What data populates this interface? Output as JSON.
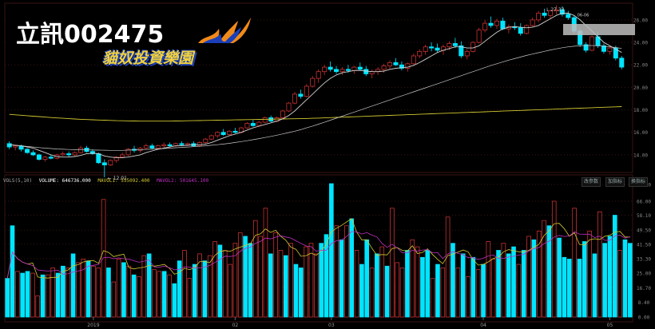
{
  "header": {
    "title": "立訊002475",
    "logo_text": "貓奴投資樂園"
  },
  "colors": {
    "up": "#c83232",
    "down": "#00e5ff",
    "ma_short": "#d0d0d0",
    "ma_long": "#c8c8c8",
    "ma_200": "#d2c830",
    "vol_ma1": "#d2c830",
    "vol_ma2": "#c030c0",
    "grid": "#3a1414"
  },
  "volume_panel": {
    "indicator": "VOLS(5,10)",
    "volume_label": "VOLUME: 646736.000",
    "mavol1_label": "MAVOL1: 555092.400",
    "mavol2_label": "MAVOL2: 501645.100",
    "buttons": [
      "改参数",
      "加指标",
      "换指标"
    ]
  },
  "chart_data": [
    {
      "type": "candlestick",
      "yaxis_ticks": [
        "26.00",
        "24.00",
        "22.00",
        "20.00",
        "18.00",
        "16.00",
        "14.00"
      ],
      "ylim": [
        13,
        27.2
      ],
      "annotations": [
        {
          "text": "12.01",
          "value": 12.01
        },
        {
          "text": "27.33",
          "value": 27.33
        },
        {
          "text": "06-06",
          "value": 26.3
        }
      ],
      "ohlc": [
        [
          15.0,
          15.2,
          14.5,
          14.7
        ],
        [
          14.7,
          14.9,
          14.4,
          14.8
        ],
        [
          14.8,
          14.9,
          14.3,
          14.5
        ],
        [
          14.5,
          14.6,
          14.1,
          14.2
        ],
        [
          14.2,
          14.4,
          13.9,
          14.0
        ],
        [
          14.0,
          14.1,
          13.5,
          13.6
        ],
        [
          13.6,
          13.9,
          13.4,
          13.8
        ],
        [
          13.8,
          14.0,
          13.6,
          13.7
        ],
        [
          13.7,
          14.1,
          13.6,
          14.0
        ],
        [
          14.0,
          14.3,
          13.9,
          14.1
        ],
        [
          14.1,
          14.3,
          13.8,
          14.0
        ],
        [
          14.0,
          14.3,
          13.9,
          14.2
        ],
        [
          14.2,
          14.8,
          14.1,
          14.6
        ],
        [
          14.6,
          14.8,
          14.2,
          14.3
        ],
        [
          14.3,
          14.5,
          14.0,
          14.1
        ],
        [
          14.1,
          14.2,
          13.2,
          13.3
        ],
        [
          13.3,
          13.6,
          12.0,
          13.1
        ],
        [
          13.1,
          13.6,
          13.0,
          13.5
        ],
        [
          13.5,
          13.9,
          13.3,
          13.8
        ],
        [
          13.8,
          14.2,
          13.7,
          14.0
        ],
        [
          14.0,
          14.6,
          13.9,
          14.5
        ],
        [
          14.5,
          14.8,
          14.2,
          14.4
        ],
        [
          14.4,
          14.7,
          14.2,
          14.6
        ],
        [
          14.6,
          15.0,
          14.5,
          14.8
        ],
        [
          14.8,
          15.0,
          14.5,
          14.6
        ],
        [
          14.6,
          14.9,
          14.5,
          14.8
        ],
        [
          14.8,
          15.1,
          14.6,
          14.9
        ],
        [
          14.9,
          15.1,
          14.7,
          14.8
        ],
        [
          14.8,
          15.1,
          14.7,
          15.0
        ],
        [
          15.0,
          15.2,
          14.8,
          14.9
        ],
        [
          14.9,
          15.1,
          14.8,
          15.0
        ],
        [
          15.0,
          15.2,
          14.7,
          14.8
        ],
        [
          14.8,
          15.2,
          14.7,
          15.1
        ],
        [
          15.1,
          15.5,
          15.0,
          15.4
        ],
        [
          15.4,
          15.8,
          15.3,
          15.7
        ],
        [
          15.7,
          16.1,
          15.5,
          16.0
        ],
        [
          16.0,
          16.3,
          15.7,
          15.8
        ],
        [
          15.8,
          16.2,
          15.7,
          16.1
        ],
        [
          16.1,
          16.4,
          15.9,
          16.0
        ],
        [
          16.0,
          16.5,
          15.9,
          16.4
        ],
        [
          16.4,
          16.9,
          16.3,
          16.8
        ],
        [
          16.8,
          17.1,
          16.5,
          16.6
        ],
        [
          16.6,
          17.0,
          16.5,
          16.9
        ],
        [
          16.9,
          17.4,
          16.8,
          17.3
        ],
        [
          17.3,
          17.5,
          16.9,
          17.0
        ],
        [
          17.0,
          17.4,
          16.9,
          17.3
        ],
        [
          17.3,
          18.0,
          17.2,
          17.9
        ],
        [
          17.9,
          18.7,
          17.8,
          18.6
        ],
        [
          18.6,
          19.6,
          18.5,
          19.4
        ],
        [
          19.4,
          19.8,
          19.0,
          19.2
        ],
        [
          19.2,
          20.3,
          19.1,
          20.1
        ],
        [
          20.1,
          21.0,
          20.0,
          20.8
        ],
        [
          20.8,
          21.6,
          20.4,
          21.4
        ],
        [
          21.4,
          22.0,
          21.1,
          21.8
        ],
        [
          21.8,
          22.3,
          21.4,
          21.6
        ],
        [
          21.6,
          21.9,
          21.2,
          21.4
        ],
        [
          21.4,
          21.8,
          21.1,
          21.6
        ],
        [
          21.6,
          22.0,
          21.3,
          21.5
        ],
        [
          21.5,
          21.9,
          21.2,
          21.8
        ],
        [
          21.8,
          22.2,
          21.5,
          21.6
        ],
        [
          21.6,
          21.9,
          21.0,
          21.2
        ],
        [
          21.2,
          21.6,
          20.8,
          21.4
        ],
        [
          21.4,
          21.8,
          21.1,
          21.6
        ],
        [
          21.6,
          22.1,
          21.3,
          21.9
        ],
        [
          21.9,
          22.4,
          21.6,
          22.2
        ],
        [
          22.2,
          22.6,
          21.9,
          22.0
        ],
        [
          22.0,
          22.3,
          21.5,
          21.7
        ],
        [
          21.7,
          22.2,
          21.4,
          22.1
        ],
        [
          22.1,
          23.0,
          22.0,
          22.8
        ],
        [
          22.8,
          23.4,
          22.6,
          23.2
        ],
        [
          23.2,
          23.8,
          22.9,
          23.6
        ],
        [
          23.6,
          24.0,
          23.2,
          23.5
        ],
        [
          23.5,
          23.9,
          23.1,
          23.3
        ],
        [
          23.3,
          23.8,
          22.9,
          23.6
        ],
        [
          23.6,
          24.1,
          23.3,
          23.9
        ],
        [
          23.9,
          24.4,
          23.5,
          23.7
        ],
        [
          23.7,
          24.1,
          22.6,
          22.8
        ],
        [
          22.8,
          23.4,
          22.5,
          23.2
        ],
        [
          23.2,
          24.1,
          23.1,
          24.0
        ],
        [
          24.0,
          25.3,
          23.9,
          25.1
        ],
        [
          25.1,
          26.0,
          24.9,
          25.7
        ],
        [
          25.7,
          26.3,
          25.3,
          25.5
        ],
        [
          25.5,
          26.1,
          25.2,
          25.9
        ],
        [
          25.9,
          26.2,
          25.1,
          25.2
        ],
        [
          25.2,
          25.6,
          24.8,
          25.4
        ],
        [
          25.4,
          25.8,
          25.1,
          25.3
        ],
        [
          25.3,
          25.7,
          24.6,
          24.8
        ],
        [
          24.8,
          25.6,
          24.7,
          25.5
        ],
        [
          25.5,
          26.2,
          25.4,
          26.0
        ],
        [
          26.0,
          26.8,
          25.8,
          26.6
        ],
        [
          26.6,
          27.0,
          26.2,
          26.4
        ],
        [
          26.4,
          26.9,
          26.1,
          26.8
        ],
        [
          26.8,
          27.3,
          26.5,
          26.9
        ],
        [
          26.9,
          27.2,
          26.3,
          26.5
        ],
        [
          26.5,
          26.8,
          26.0,
          26.2
        ],
        [
          26.2,
          26.4,
          24.8,
          25.0
        ],
        [
          25.0,
          25.2,
          23.6,
          23.8
        ],
        [
          23.8,
          24.0,
          23.1,
          23.3
        ],
        [
          23.3,
          24.6,
          23.2,
          24.5
        ],
        [
          24.5,
          24.9,
          23.5,
          23.7
        ],
        [
          23.7,
          23.9,
          23.0,
          23.2
        ],
        [
          23.2,
          23.6,
          22.9,
          23.5
        ],
        [
          23.5,
          23.7,
          22.4,
          22.6
        ],
        [
          22.6,
          22.8,
          21.6,
          21.8
        ]
      ],
      "ma_short": [
        14.9,
        14.85,
        14.8,
        14.7,
        14.6,
        14.4,
        14.2,
        14.0,
        13.85,
        13.8,
        13.8,
        13.85,
        13.95,
        14.1,
        14.15,
        14.1,
        13.9,
        13.8,
        13.75,
        13.75,
        13.8,
        13.9,
        14.0,
        14.2,
        14.35,
        14.5,
        14.6,
        14.7,
        14.8,
        14.8,
        14.85,
        14.9,
        14.9,
        14.95,
        15.1,
        15.3,
        15.5,
        15.7,
        15.85,
        16.0,
        16.2,
        16.4,
        16.55,
        16.7,
        16.85,
        17.0,
        17.2,
        17.5,
        17.9,
        18.4,
        18.9,
        19.4,
        19.9,
        20.4,
        20.8,
        21.1,
        21.3,
        21.4,
        21.5,
        21.5,
        21.45,
        21.4,
        21.4,
        21.45,
        21.6,
        21.7,
        21.75,
        21.8,
        21.95,
        22.2,
        22.5,
        22.8,
        23.1,
        23.3,
        23.45,
        23.6,
        23.6,
        23.5,
        23.5,
        23.7,
        24.1,
        24.5,
        24.9,
        25.2,
        25.35,
        25.4,
        25.35,
        25.3,
        25.35,
        25.5,
        25.8,
        26.1,
        26.4,
        26.6,
        26.6,
        26.4,
        26.0,
        25.5,
        25.0,
        24.5,
        24.0,
        23.7,
        23.4,
        23.1
      ],
      "ma_long": [
        14.9,
        14.85,
        14.8,
        14.75,
        14.7,
        14.65,
        14.6,
        14.56,
        14.52,
        14.5,
        14.48,
        14.46,
        14.45,
        14.44,
        14.43,
        14.42,
        14.41,
        14.4,
        14.4,
        14.4,
        14.42,
        14.44,
        14.46,
        14.48,
        14.5,
        14.53,
        14.56,
        14.6,
        14.63,
        14.66,
        14.7,
        14.73,
        14.76,
        14.8,
        14.85,
        14.9,
        14.96,
        15.02,
        15.1,
        15.18,
        15.26,
        15.35,
        15.44,
        15.54,
        15.64,
        15.75,
        15.86,
        15.98,
        16.1,
        16.24,
        16.4,
        16.56,
        16.73,
        16.9,
        17.08,
        17.26,
        17.44,
        17.62,
        17.8,
        17.98,
        18.16,
        18.34,
        18.52,
        18.7,
        18.88,
        19.06,
        19.24,
        19.42,
        19.6,
        19.78,
        19.96,
        20.14,
        20.32,
        20.5,
        20.68,
        20.86,
        21.04,
        21.22,
        21.4,
        21.58,
        21.76,
        21.94,
        22.1,
        22.26,
        22.42,
        22.56,
        22.7,
        22.84,
        22.96,
        23.08,
        23.2,
        23.32,
        23.42,
        23.52,
        23.6,
        23.66,
        23.7,
        23.72,
        23.72,
        23.7,
        23.66,
        23.6,
        23.54,
        23.46
      ],
      "ma_200": [
        17.6,
        17.56,
        17.52,
        17.48,
        17.44,
        17.4,
        17.36,
        17.32,
        17.28,
        17.25,
        17.22,
        17.19,
        17.16,
        17.14,
        17.12,
        17.1,
        17.08,
        17.06,
        17.04,
        17.03,
        17.02,
        17.01,
        17.0,
        17.0,
        17.0,
        17.0,
        17.0,
        17.0,
        17.01,
        17.02,
        17.03,
        17.04,
        17.05,
        17.06,
        17.07,
        17.08,
        17.09,
        17.1,
        17.11,
        17.12,
        17.13,
        17.14,
        17.15,
        17.16,
        17.17,
        17.18,
        17.19,
        17.2,
        17.21,
        17.22,
        17.23,
        17.25,
        17.27,
        17.29,
        17.31,
        17.33,
        17.35,
        17.37,
        17.39,
        17.41,
        17.43,
        17.45,
        17.47,
        17.49,
        17.51,
        17.53,
        17.55,
        17.57,
        17.59,
        17.61,
        17.63,
        17.65,
        17.67,
        17.69,
        17.71,
        17.73,
        17.75,
        17.77,
        17.79,
        17.81,
        17.83,
        17.85,
        17.87,
        17.89,
        17.91,
        17.93,
        17.95,
        17.97,
        17.99,
        18.01,
        18.03,
        18.05,
        18.07,
        18.09,
        18.11,
        18.13,
        18.15,
        18.17,
        18.19,
        18.21,
        18.23,
        18.25,
        18.27,
        18.29
      ]
    },
    {
      "type": "bar",
      "title": "VOLS(5,10)",
      "yaxis_ticks": [
        "75.60",
        "66.00",
        "58.10",
        "49.50",
        "41.50",
        "33.30",
        "25.00",
        "16.70",
        "8.40",
        "0.00"
      ],
      "ylim": [
        0,
        76
      ],
      "xaxis_labels": [
        {
          "text": "2019",
          "index": 17
        },
        {
          "text": "02",
          "index": 45
        },
        {
          "text": "03",
          "index": 64
        },
        {
          "text": "04",
          "index": 94
        },
        {
          "text": "05",
          "index": 119
        }
      ],
      "volumes": [
        22,
        52,
        26,
        25,
        26,
        25,
        12,
        24,
        24,
        28,
        25,
        29,
        28,
        36,
        31,
        33,
        32,
        29,
        28,
        67,
        28,
        20,
        33,
        31,
        29,
        24,
        23,
        35,
        36,
        27,
        26,
        26,
        24,
        19,
        32,
        38,
        22,
        30,
        36,
        32,
        35,
        43,
        41,
        38,
        30,
        42,
        48,
        46,
        42,
        55,
        46,
        62,
        36,
        48,
        38,
        35,
        42,
        30,
        28,
        40,
        42,
        36,
        42,
        47,
        76,
        52,
        44,
        52,
        56,
        38,
        30,
        44,
        28,
        36,
        40,
        29,
        62,
        31,
        28,
        38,
        44,
        40,
        34,
        38,
        22,
        30,
        28,
        57,
        42,
        28,
        36,
        23,
        34,
        27,
        30,
        43,
        33,
        38,
        42,
        36,
        40,
        30,
        38,
        46,
        44,
        49,
        55,
        52,
        66,
        45,
        34,
        33,
        62,
        33,
        43,
        49,
        36,
        60,
        42,
        46,
        58,
        38,
        44,
        42
      ],
      "vol_up": [
        0,
        0,
        1,
        0,
        0,
        1,
        1,
        0,
        1,
        1,
        0,
        0,
        1,
        0,
        1,
        1,
        0,
        1,
        1,
        1,
        0,
        1,
        1,
        0,
        1,
        0,
        1,
        1,
        0,
        1,
        1,
        0,
        1,
        0,
        0,
        1,
        1,
        0,
        1,
        0,
        1,
        1,
        0,
        1,
        1,
        1,
        1,
        0,
        0,
        1,
        1,
        1,
        0,
        1,
        1,
        0,
        1,
        0,
        0,
        1,
        1,
        1,
        0,
        0,
        0,
        1,
        0,
        1,
        0,
        1,
        0,
        0,
        1,
        0,
        1,
        0,
        1,
        1,
        1,
        0,
        1,
        1,
        0,
        0,
        1,
        0,
        1,
        1,
        0,
        1,
        0,
        1,
        0,
        1,
        0,
        1,
        1,
        0,
        1,
        0,
        0,
        1,
        0,
        1,
        0,
        1,
        1,
        0,
        1,
        0,
        0,
        0,
        1,
        0,
        0,
        1,
        0,
        1,
        0,
        0,
        0,
        1,
        0,
        0
      ]
    }
  ]
}
